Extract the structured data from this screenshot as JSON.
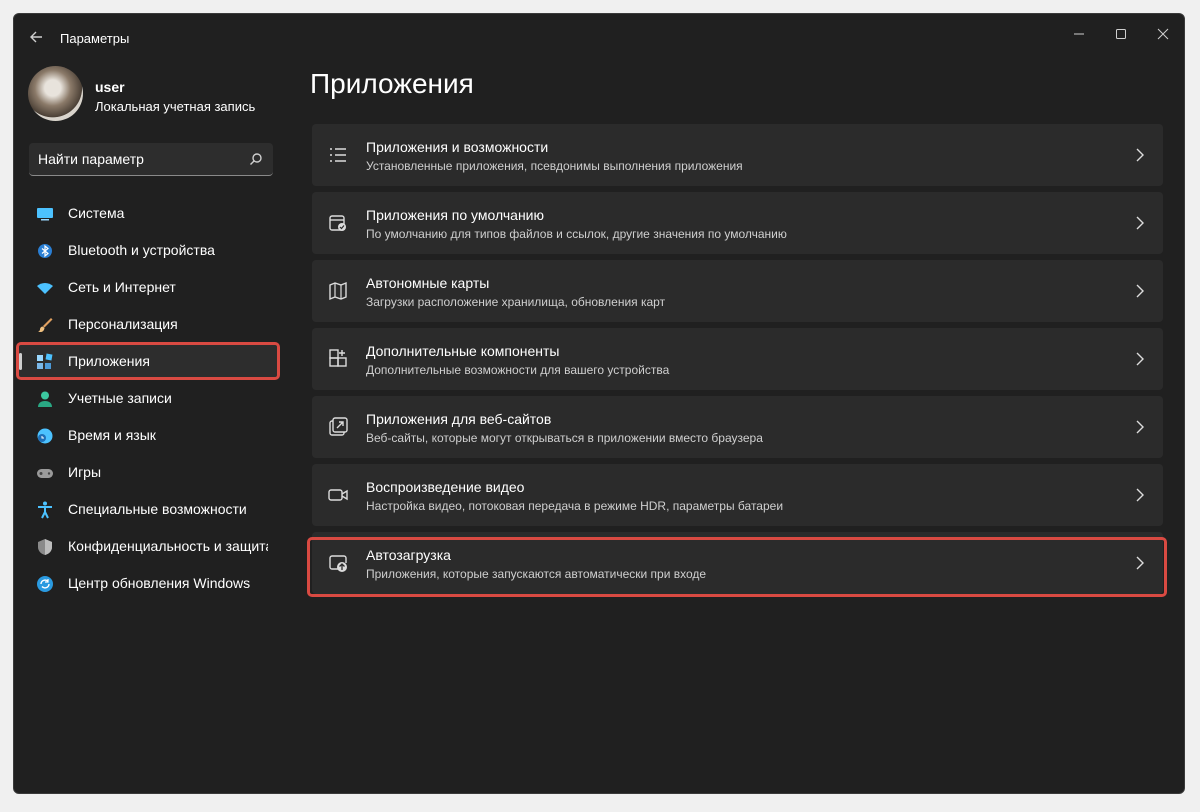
{
  "window": {
    "title": "Параметры"
  },
  "user": {
    "name": "user",
    "account_type": "Локальная учетная запись"
  },
  "search": {
    "placeholder": "Найти параметр"
  },
  "sidebar": {
    "items": [
      {
        "label": "Система",
        "icon": "monitor-icon",
        "selected": false
      },
      {
        "label": "Bluetooth и устройства",
        "icon": "bluetooth-icon",
        "selected": false
      },
      {
        "label": "Сеть и Интернет",
        "icon": "wifi-icon",
        "selected": false
      },
      {
        "label": "Персонализация",
        "icon": "brush-icon",
        "selected": false
      },
      {
        "label": "Приложения",
        "icon": "apps-icon",
        "selected": true
      },
      {
        "label": "Учетные записи",
        "icon": "person-icon",
        "selected": false
      },
      {
        "label": "Время и язык",
        "icon": "globe-clock-icon",
        "selected": false
      },
      {
        "label": "Игры",
        "icon": "gamepad-icon",
        "selected": false
      },
      {
        "label": "Специальные возможности",
        "icon": "accessibility-icon",
        "selected": false
      },
      {
        "label": "Конфиденциальность и защита",
        "icon": "shield-icon",
        "selected": false
      },
      {
        "label": "Центр обновления Windows",
        "icon": "update-icon",
        "selected": false
      }
    ]
  },
  "main": {
    "title": "Приложения",
    "cards": [
      {
        "title": "Приложения и возможности",
        "subtitle": "Установленные приложения, псевдонимы выполнения приложения",
        "icon": "list-icon"
      },
      {
        "title": "Приложения по умолчанию",
        "subtitle": "По умолчанию для типов файлов и ссылок, другие значения по умолчанию",
        "icon": "default-apps-icon"
      },
      {
        "title": "Автономные карты",
        "subtitle": "Загрузки расположение хранилища, обновления карт",
        "icon": "map-icon"
      },
      {
        "title": "Дополнительные компоненты",
        "subtitle": "Дополнительные возможности для вашего устройства",
        "icon": "add-components-icon"
      },
      {
        "title": "Приложения для веб-сайтов",
        "subtitle": "Веб-сайты, которые могут открываться в приложении вместо браузера",
        "icon": "open-external-icon"
      },
      {
        "title": "Воспроизведение видео",
        "subtitle": "Настройка видео, потоковая передача в режиме HDR, параметры батареи",
        "icon": "video-icon"
      },
      {
        "title": "Автозагрузка",
        "subtitle": "Приложения, которые запускаются автоматически при входе",
        "icon": "startup-icon"
      }
    ]
  },
  "colors": {
    "background": "#202020",
    "card": "#2b2b2b",
    "highlight": "#d94a42",
    "accent": "#4cc2ff"
  }
}
